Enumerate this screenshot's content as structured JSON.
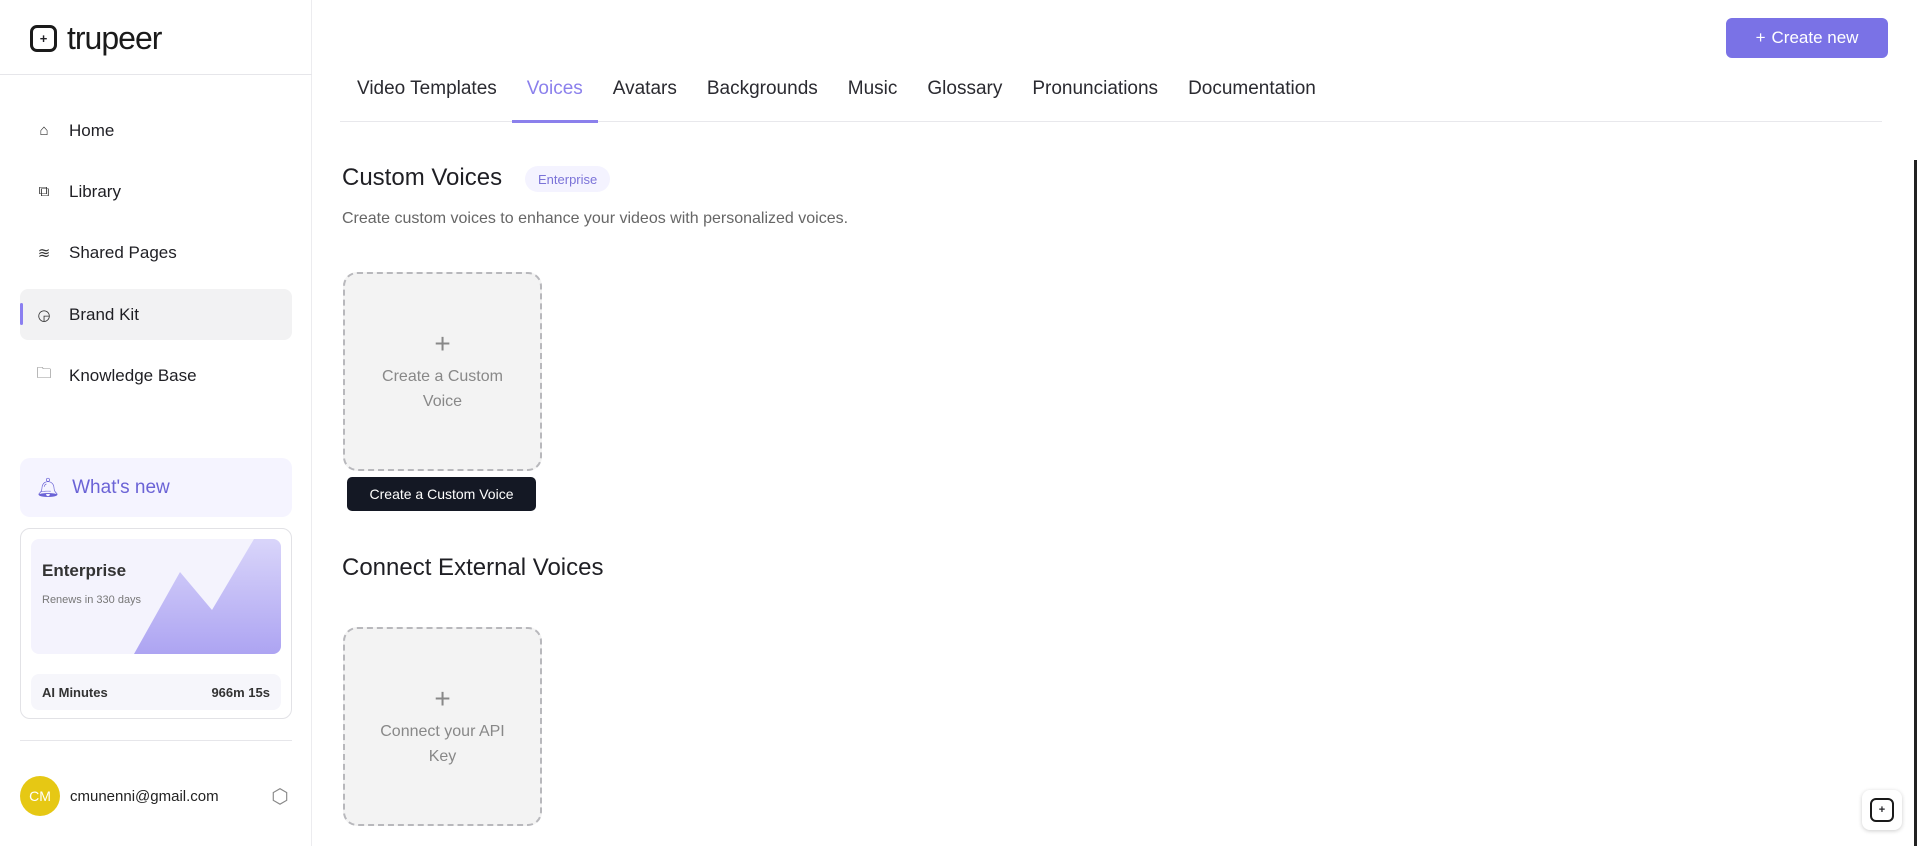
{
  "sidebar": {
    "logo": "trupeer",
    "items": [
      {
        "label": "Home",
        "icon": "home-icon"
      },
      {
        "label": "Library",
        "icon": "library-icon"
      },
      {
        "label": "Shared Pages",
        "icon": "layers-icon"
      },
      {
        "label": "Brand Kit",
        "icon": "brand-kit-icon"
      },
      {
        "label": "Knowledge Base",
        "icon": "folder-icon"
      }
    ],
    "whats_new": "What's new",
    "plan": {
      "name": "Enterprise",
      "renews": "Renews in 330 days",
      "minutes_label": "AI Minutes",
      "minutes_value": "966m 15s"
    },
    "user": {
      "initials": "CM",
      "email": "cmunenni@gmail.com"
    }
  },
  "header": {
    "create_new": "Create new"
  },
  "tabs": [
    "Video Templates",
    "Voices",
    "Avatars",
    "Backgrounds",
    "Music",
    "Glossary",
    "Pronunciations",
    "Documentation"
  ],
  "custom": {
    "title": "Custom Voices",
    "badge": "Enterprise",
    "subtitle": "Create custom voices to enhance your videos with personalized voices.",
    "tile": "Create a Custom Voice",
    "tooltip": "Create a Custom Voice"
  },
  "external": {
    "title": "Connect External Voices",
    "tile": "Connect your API Key"
  },
  "colors": {
    "accent": "#7a72e6",
    "avatar": "#e6c814"
  }
}
